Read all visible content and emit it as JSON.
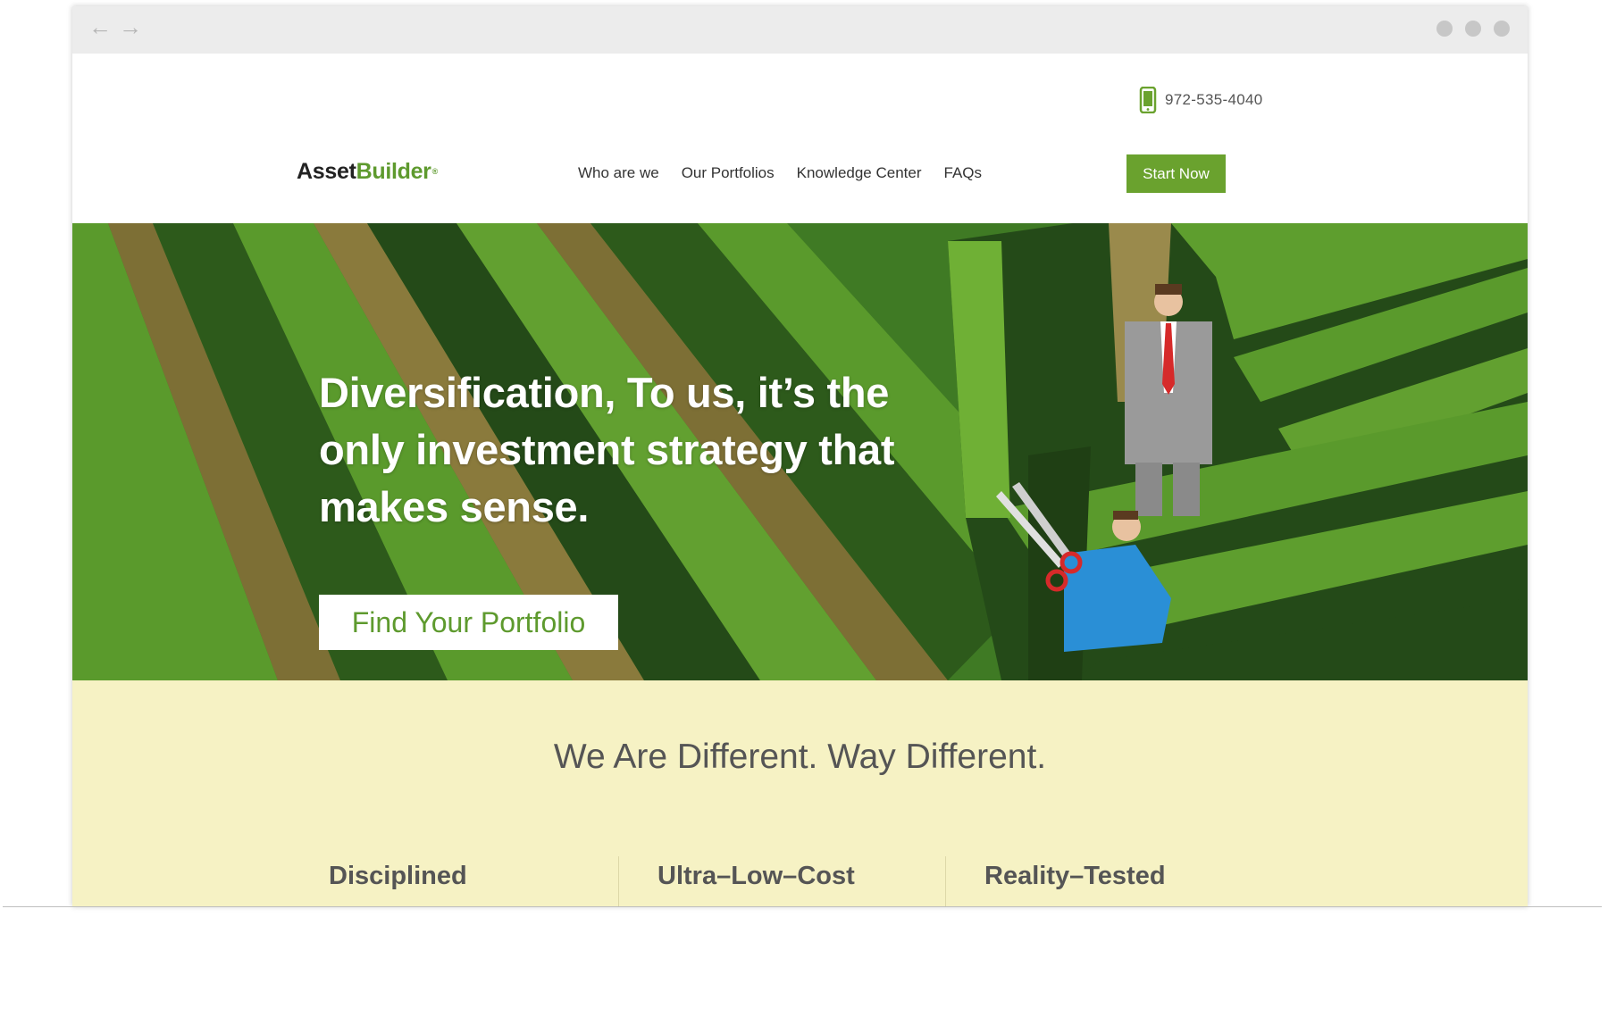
{
  "browser": {
    "back_icon": "arrow-left-icon",
    "forward_icon": "arrow-right-icon",
    "back_glyph": "←",
    "forward_glyph": "→"
  },
  "header": {
    "phone": "972-535-4040",
    "phone_icon": "mobile-phone-icon",
    "logo_part1": "Asset",
    "logo_part2": "Builder",
    "logo_mark": "®",
    "nav": [
      "Who are we",
      "Our Portfolios",
      "Knowledge Center",
      "FAQs"
    ],
    "cta": "Start Now"
  },
  "hero": {
    "title": "Diversification, To us, it’s the only investment strategy that makes sense.",
    "button": "Find Your Portfolio"
  },
  "different": {
    "title": "We Are Different. Way Different.",
    "features": [
      "Disciplined",
      "Ultra–Low–Cost",
      "Reality–Tested"
    ]
  },
  "colors": {
    "brand_green": "#6aa22e",
    "hedge_light": "#5a9a2c",
    "hedge_dark": "#244a18",
    "path_tan": "#8a7a3c",
    "section_bg": "#f6f2c4"
  }
}
